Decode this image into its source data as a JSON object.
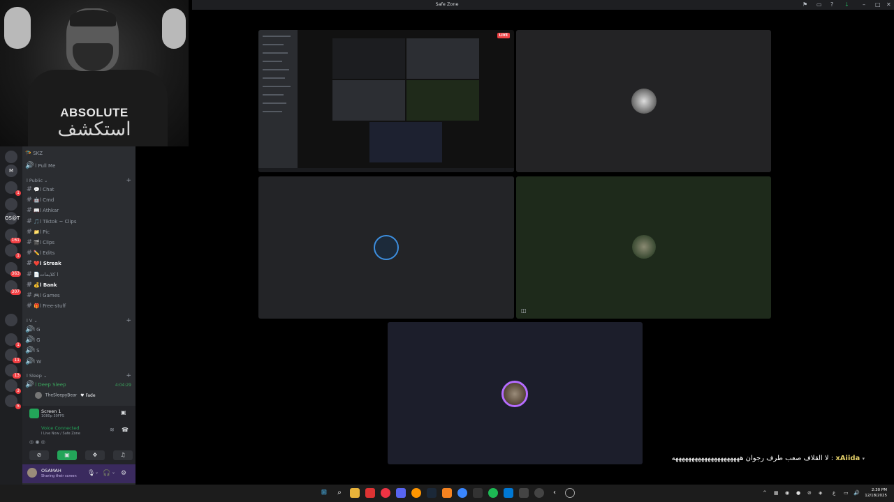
{
  "window": {
    "title": "Safe Zone"
  },
  "webcam": {
    "title": "ABSOLUTE",
    "subtitle": "استكشف"
  },
  "servers": [
    {
      "label": "",
      "badge": ""
    },
    {
      "label": "M",
      "badge": ""
    },
    {
      "label": "",
      "badge": "1"
    },
    {
      "label": "",
      "badge": ""
    },
    {
      "label": "OS@T",
      "badge": ""
    },
    {
      "label": "",
      "badge": "161"
    },
    {
      "label": "",
      "badge": "1"
    },
    {
      "label": "",
      "badge": "363"
    },
    {
      "label": "",
      "badge": "307"
    },
    {
      "label": "",
      "badge": ""
    },
    {
      "label": "",
      "badge": "1"
    },
    {
      "label": "",
      "badge": "11"
    },
    {
      "label": "",
      "badge": "13"
    },
    {
      "label": "",
      "badge": "3"
    },
    {
      "label": "",
      "badge": "5"
    }
  ],
  "sidebar": {
    "top_items": [
      {
        "label": "SKZ",
        "icon": "🪂"
      },
      {
        "label": "ا Pull Me",
        "icon": "🔊"
      }
    ],
    "category_public": "ا Public ⌄",
    "channels": [
      {
        "label": "ا Chat",
        "icon": "💬",
        "bold": false
      },
      {
        "label": "ا Cmd",
        "icon": "🤖",
        "bold": false
      },
      {
        "label": "ا Athkar",
        "icon": "📖",
        "bold": false
      },
      {
        "label": "ا Tiktok ~ Clips",
        "icon": "🎵",
        "bold": false
      },
      {
        "label": "ا Pic",
        "icon": "📁",
        "bold": false
      },
      {
        "label": "ا Clips",
        "icon": "🎬",
        "bold": false
      },
      {
        "label": "ا Edits",
        "icon": "✏️",
        "bold": false
      },
      {
        "label": "ا Streak",
        "icon": "❤️",
        "bold": true
      },
      {
        "label": "ا كلايمات",
        "icon": "📄",
        "bold": false
      },
      {
        "label": "ا Bank",
        "icon": "💰",
        "bold": true
      },
      {
        "label": "ا Games",
        "icon": "🎮",
        "bold": false
      },
      {
        "label": "ا Free-stuff",
        "icon": "🎁",
        "bold": false
      }
    ],
    "category_v": "ا V ⌄",
    "voice_channels": [
      {
        "label": "ا G"
      },
      {
        "label": "ا G"
      },
      {
        "label": "ا S"
      },
      {
        "label": "ا W"
      }
    ],
    "category_sleep": "ا Sleep ⌄",
    "deep_sleep": {
      "label": "ا Deep Sleep",
      "timer": "4:04:29"
    },
    "member": {
      "name": "TheSleepyBear",
      "tag": "♥ Fade"
    }
  },
  "stream_panel": {
    "title": "Screen 1",
    "subtitle": "1080p 30FPS"
  },
  "voice_panel": {
    "title": "Voice Connected",
    "subtitle": "ا Live Now / Safe Zone"
  },
  "user_panel": {
    "name": "OSAMAH",
    "status": "Sharing their screen"
  },
  "live_badge": "LIVE",
  "chat_overlay": {
    "name": "xAiida",
    "message": "لا القلاف صعب طرف رجوان هههههههههههههههههههههه :"
  },
  "taskbar": {
    "time": "2:30 PM",
    "date": "12/18/2025",
    "lang": "ع"
  },
  "colors": {
    "accent": "#5865f2",
    "live": "#ed4245",
    "voice": "#23a559",
    "speaking": "#b56cff"
  }
}
